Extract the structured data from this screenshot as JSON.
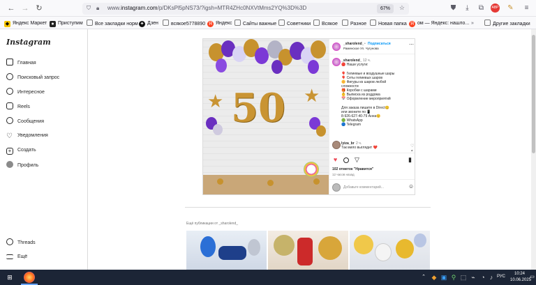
{
  "browser": {
    "url_prefix": "www.",
    "url_domain": "instagram.com",
    "url_path": "/p/DKsPl5pNS73/?igsh=MTR4ZHc0NXVtMms2YQ%3D%3D",
    "zoom": "67%"
  },
  "bookmarks": [
    {
      "label": "Яндекс Маркет",
      "color": "#f5c400"
    },
    {
      "label": "Приступим",
      "color": "#222222"
    },
    {
      "label": "Все закладки норм",
      "color": "#7a7a7a"
    },
    {
      "label": "Дзен",
      "color": "#111111"
    },
    {
      "label": "всякое5778890",
      "color": "#7a7a7a"
    },
    {
      "label": "Яндекс",
      "color": "#fc3f1d"
    },
    {
      "label": "Сайты важные",
      "color": "#7a7a7a"
    },
    {
      "label": "Советники",
      "color": "#7a7a7a"
    },
    {
      "label": "Всякое",
      "color": "#7a7a7a"
    },
    {
      "label": "Разное",
      "color": "#7a7a7a"
    },
    {
      "label": "Новая папка",
      "color": "#7a7a7a"
    },
    {
      "label": "ом — Яндекс: нашло...",
      "color": "#fc3f1d"
    },
    {
      "label": "Другие закладки",
      "color": "#7a7a7a"
    }
  ],
  "sidebar": {
    "logo": "Instagram",
    "items": [
      {
        "label": "Главная",
        "icon": "home-icon"
      },
      {
        "label": "Поисковый запрос",
        "icon": "search-icon"
      },
      {
        "label": "Интересное",
        "icon": "compass-icon"
      },
      {
        "label": "Reels",
        "icon": "reels-icon"
      },
      {
        "label": "Сообщения",
        "icon": "messenger-icon"
      },
      {
        "label": "Уведомления",
        "icon": "heart-icon"
      },
      {
        "label": "Создать",
        "icon": "plus-icon"
      },
      {
        "label": "Профиль",
        "icon": "profile-avatar"
      }
    ],
    "bottom": [
      {
        "label": "Threads",
        "icon": "threads-icon"
      },
      {
        "label": "Ещё",
        "icon": "menu-icon"
      }
    ]
  },
  "post": {
    "username": "_sharolend_",
    "follow": "Подписаться",
    "location": "Раменское Ул. Чугунова",
    "caption_user": "_sharolend_",
    "caption_time": "12 ч.",
    "caption_lines": [
      "🔴 Наши услуги:",
      "",
      "🎈 Гелиевые и воздушные шары",
      "🎈 Сеты гелиевых шаров",
      "🌼 Фигуры из шаров любой",
      "сложности",
      "🎁 Коробки с шарами",
      "👶 Выписка из роддома",
      "📅 Оформление мероприятий",
      "",
      "Для заказа пишите в Direct😊",
      "или звоните по 📱",
      "8-926-627-40-79 Анна😊",
      "🟢 WhatsApp",
      "🔵 Telegram"
    ],
    "comment_user": "lyiza_br",
    "comment_time": "2 ч.",
    "comment_text": "Так мило выглядит ❤️",
    "likes": "102 отметок \"Нравится\"",
    "post_time": "12 часов назад",
    "add_comment": "Добавьте комментарий...",
    "photo_number": "50"
  },
  "more_posts": {
    "label": "Ещё публикации от _sharolend_"
  },
  "taskbar": {
    "time": "10:24",
    "date": "10.06.2025",
    "lang": "РУС"
  }
}
